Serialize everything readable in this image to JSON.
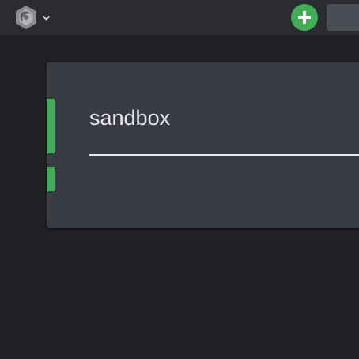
{
  "topbar": {
    "logo_icon": "app-logo-icon",
    "menu_icon": "chevron-down-icon",
    "add_icon": "plus-icon",
    "add_color": "#3fae55"
  },
  "card": {
    "title_value": "sandbox",
    "accent_color": "#3fae55"
  }
}
